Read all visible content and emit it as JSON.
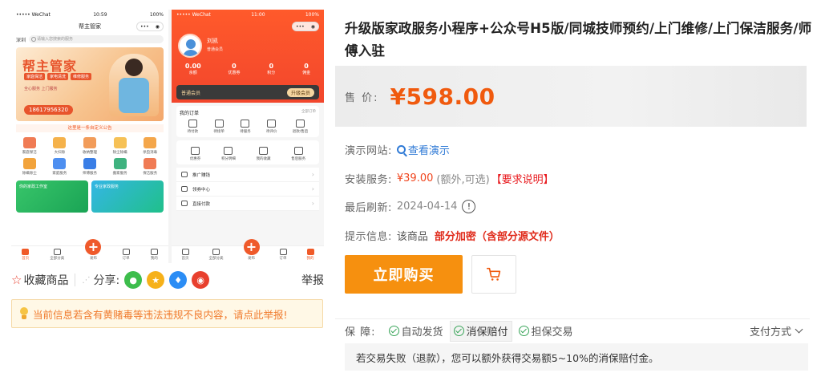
{
  "preview": {
    "left_phone": {
      "carrier": "••••• WeChat",
      "time": "10:59",
      "battery": "100%",
      "title": "帮主管家",
      "location": "深圳",
      "search_placeholder": "请输入您搜索的服务",
      "banner_logo": "帮主管家",
      "banner_tags": [
        "家庭保洁",
        "家电清洗",
        "维修服务"
      ],
      "banner_mini": "全心服务 上门服务",
      "banner_phone": "18617956320",
      "notice": "这里是一条自定义公告",
      "services": [
        "家庭保洁",
        "大扫除",
        "收纳整理",
        "除尘除螨",
        "杀虫消毒",
        "除螨除尘",
        "家庭服务",
        "师傅服务",
        "搬家服务",
        "保洁服务"
      ],
      "promo1": "你的家政工作室",
      "promo2": "专业家政服务"
    },
    "right_phone": {
      "carrier": "••••• WeChat",
      "time": "11:00",
      "battery": "100%",
      "user_name": "刘凯",
      "user_role": "普通会员",
      "stats": [
        {
          "value": "0.00",
          "label": "余额"
        },
        {
          "value": "0",
          "label": "优惠券"
        },
        {
          "value": "0",
          "label": "积分"
        },
        {
          "value": "0",
          "label": "佣金"
        }
      ],
      "member_label": "普通会员",
      "member_btn": "升级会员",
      "orders_title": "我的订单",
      "orders_all": "全部订单",
      "order_icons": [
        "待付款",
        "待接单",
        "待服务",
        "待评价",
        "退款/售后"
      ],
      "tool_icons": [
        "优惠券",
        "积分明细",
        "我的收藏",
        "售后服务"
      ],
      "menu": [
        "推广赚钱",
        "领券中心",
        "直接付款"
      ]
    },
    "tabbar_left": [
      "首页",
      "全部分类",
      "发布",
      "订单",
      "我的"
    ],
    "tabbar_right": [
      "首页",
      "全部分类",
      "发布",
      "订单",
      "我的"
    ]
  },
  "actions": {
    "favorite": "收藏商品",
    "share_label": "分享:",
    "report": "举报"
  },
  "warning": "当前信息若含有黄赌毒等违法违规不良内容，请点此举报!",
  "product": {
    "title": "升级版家政服务小程序+公众号H5版/同城技师预约/上门维修/上门保洁服务/师傅入驻",
    "price_label": "售 价:",
    "price": "¥598.00"
  },
  "info": {
    "demo_label": "演示网站:",
    "demo_link": "查看演示",
    "install_label": "安装服务:",
    "install_price": "¥39.00",
    "install_note": "(额外,可选)",
    "install_req": "【要求说明】",
    "refresh_label": "最后刷新:",
    "refresh_date": "2024-04-14",
    "tips_label": "提示信息:",
    "tips_text": "该商品",
    "tips_emph": "部分加密（含部分源文件）"
  },
  "buttons": {
    "buy": "立即购买"
  },
  "guarantee": {
    "label": "保 障:",
    "items": [
      "自动发货",
      "消保赔付",
      "担保交易"
    ],
    "pay": "支付方式",
    "note": "若交易失败（退款），您可以额外获得交易额5~10%的消保赔付金。"
  },
  "colors": {
    "accent": "#f05a0e",
    "buy_button": "#f6900f",
    "link": "#2f7ad6",
    "warning_text": "#f07a2c",
    "phone_red": "#f2462c"
  }
}
